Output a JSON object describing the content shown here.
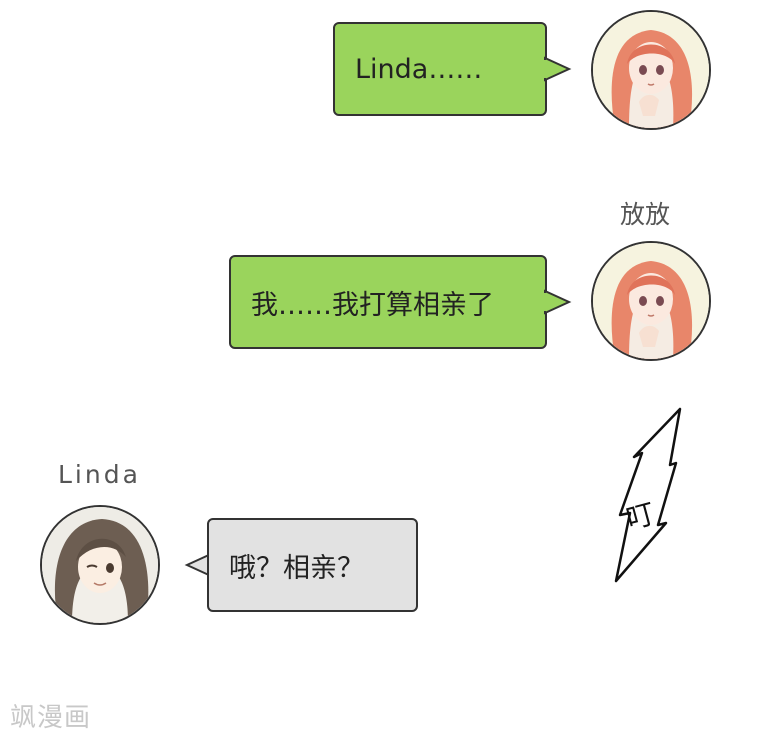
{
  "messages": [
    {
      "sender": "放放",
      "text": "Linda……"
    },
    {
      "sender": "放放",
      "text": "我……我打算相亲了"
    },
    {
      "sender": "Linda",
      "text": "哦？相亲？"
    }
  ],
  "names": {
    "fangfang": "放放",
    "linda": "Linda"
  },
  "sfx": "叮",
  "watermark": "飒漫画",
  "colors": {
    "outgoing_bubble": "#9ad45c",
    "incoming_bubble": "#e2e2e2"
  },
  "icons": {
    "avatar_fangfang": "girl-red-hair-avatar",
    "avatar_linda": "woman-brown-hair-avatar"
  }
}
